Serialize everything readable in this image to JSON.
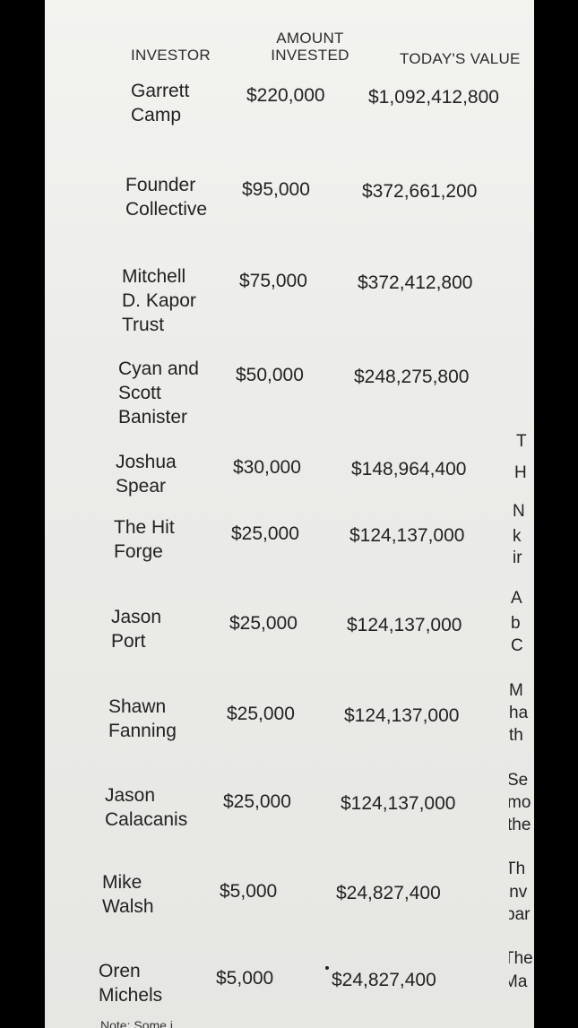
{
  "table": {
    "headers": {
      "investor": "INVESTOR",
      "amount_line1": "AMOUNT",
      "amount_line2": "INVESTED",
      "value": "TODAY'S VALUE"
    },
    "rows": [
      {
        "investor": [
          "Garrett",
          "Camp"
        ],
        "amount": "$220,000",
        "value": "$1,092,412,800"
      },
      {
        "investor": [
          "Founder",
          "Collective"
        ],
        "amount": "$95,000",
        "value": "$372,661,200"
      },
      {
        "investor": [
          "Mitchell",
          "D. Kapor",
          "Trust"
        ],
        "amount": "$75,000",
        "value": "$372,412,800"
      },
      {
        "investor": [
          "Cyan and",
          "Scott",
          "Banister"
        ],
        "amount": "$50,000",
        "value": "$248,275,800"
      },
      {
        "investor": [
          "Joshua",
          "Spear"
        ],
        "amount": "$30,000",
        "value": "$148,964,400"
      },
      {
        "investor": [
          "The Hit",
          "Forge"
        ],
        "amount": "$25,000",
        "value": "$124,137,000"
      },
      {
        "investor": [
          "Jason",
          "Port"
        ],
        "amount": "$25,000",
        "value": "$124,137,000"
      },
      {
        "investor": [
          "Shawn",
          "Fanning"
        ],
        "amount": "$25,000",
        "value": "$124,137,000"
      },
      {
        "investor": [
          "Jason",
          "Calacanis"
        ],
        "amount": "$25,000",
        "value": "$124,137,000"
      },
      {
        "investor": [
          "Mike",
          "Walsh"
        ],
        "amount": "$5,000",
        "value": "$24,827,400"
      },
      {
        "investor": [
          "Oren",
          "Michels"
        ],
        "amount": "$5,000",
        "value": "$24,827,400"
      }
    ]
  },
  "side_fragments": [
    "T",
    "H",
    "N",
    "k",
    "ir",
    "A",
    "b",
    "C",
    "M",
    "ha",
    "th",
    "Se",
    "mo",
    "the",
    "Th",
    "inv",
    "par",
    "The",
    "Ma"
  ],
  "footer_note": "Note: Some i"
}
